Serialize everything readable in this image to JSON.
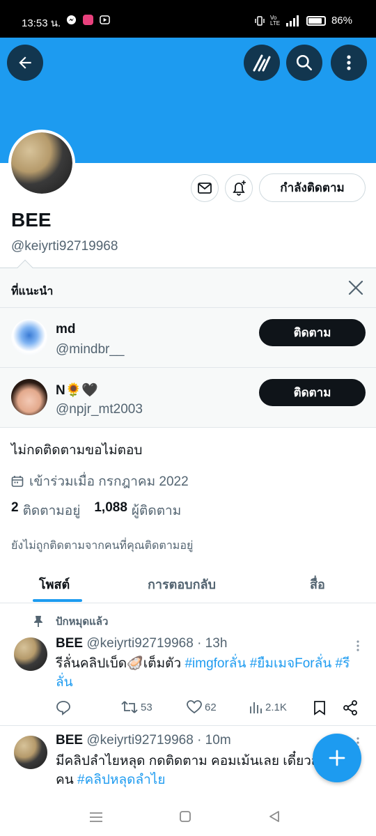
{
  "status_bar": {
    "time": "13:53 น.",
    "battery": "86%",
    "network": "5G",
    "volte": "Vo LTE"
  },
  "header": {
    "back_icon": "arrow-left-icon",
    "grok_icon": "grok-icon",
    "search_icon": "search-icon",
    "more_icon": "more-vertical-icon",
    "banner_color": "#1d9bf0"
  },
  "profile": {
    "name": "BEE",
    "handle": "@keiyrti92719968",
    "following_button": "กำลังติดตาม",
    "bio": "ไม่กดติดตามขอไม่ตอบ",
    "joined": "เข้าร่วมเมื่อ กรกฎาคม 2022",
    "following_count": "2",
    "following_label": "ติดตามอยู่",
    "followers_count": "1,088",
    "followers_label": "ผู้ติดตาม",
    "not_followed_note": "ยังไม่ถูกติดตามจากคนที่คุณติดตามอยู่"
  },
  "suggestions": {
    "title": "ที่แนะนำ",
    "follow_label": "ติดตาม",
    "items": [
      {
        "name": "md",
        "handle": "@mindbr__"
      },
      {
        "name": "N🌻🖤",
        "handle": "@npjr_mt2003"
      }
    ]
  },
  "tabs": [
    {
      "label": "โพสต์",
      "active": true
    },
    {
      "label": "การตอบกลับ",
      "active": false
    },
    {
      "label": "สื่อ",
      "active": false
    }
  ],
  "pinned_label": "ปักหมุดแล้ว",
  "tweets": [
    {
      "name": "BEE",
      "meta": "@keiyrti92719968 · 13h",
      "text_plain": "รีลั่นคลิปเบ็ด🦪เต็มตัว",
      "text_tags": "#imgforลั่น #ยืมเมจForลั่น #รีลั่น",
      "replies": "",
      "retweets": "53",
      "likes": "62",
      "views": "2.1K"
    },
    {
      "name": "BEE",
      "meta": "@keiyrti92719968 · 10m",
      "text_plain": "มีคลิปลำไยหลุด กดติดตาม คอมเม้นเลย เดี๋ยวส่งให้ทุกคน",
      "text_tags": "#คลิปหลุดลำไย"
    }
  ],
  "colors": {
    "accent": "#1d9bf0",
    "text": "#0f1419",
    "muted": "#536471"
  }
}
